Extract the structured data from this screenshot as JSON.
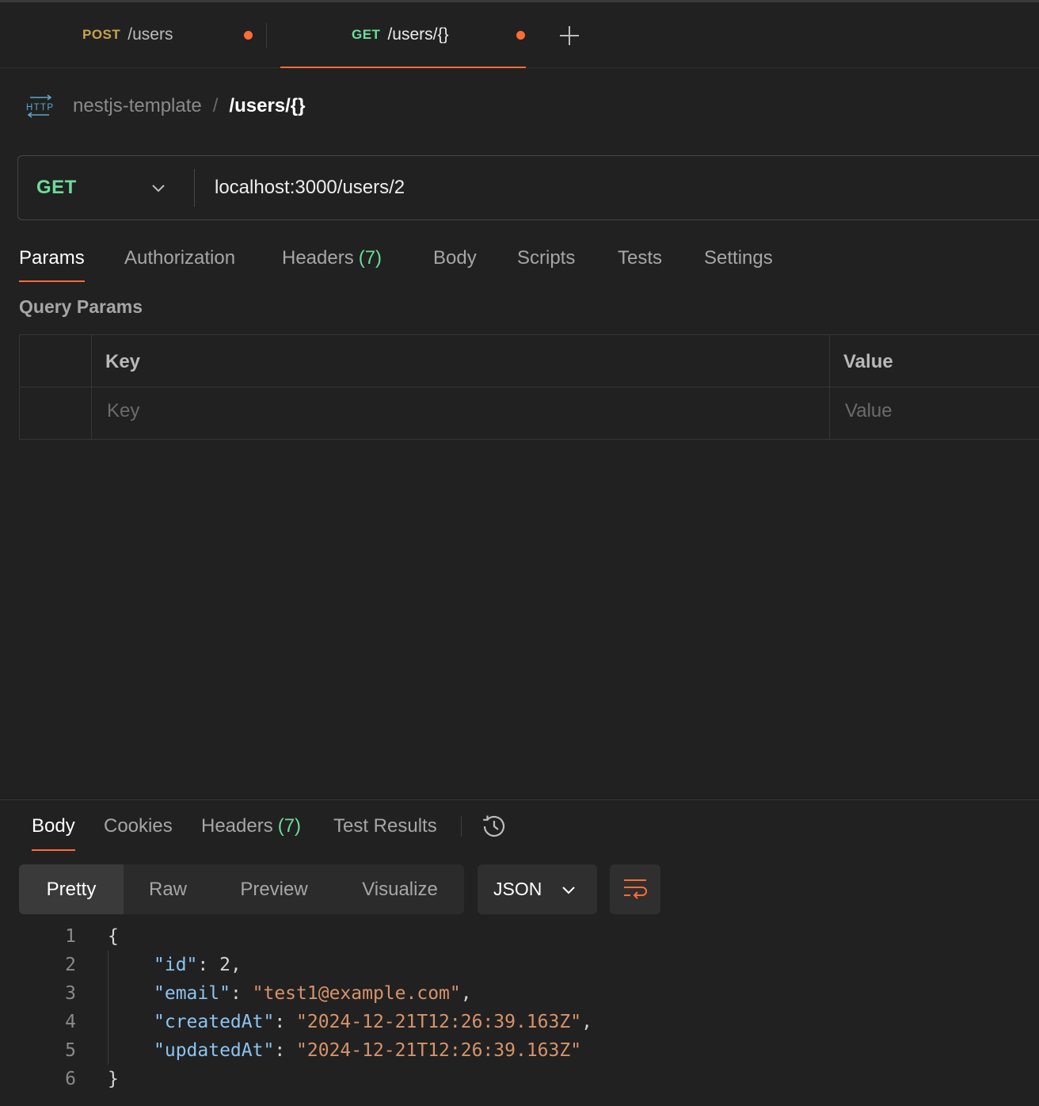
{
  "request_tabs": [
    {
      "method": "POST",
      "path": "/users",
      "method_color": "#c8a34a",
      "unsaved": true,
      "active": false
    },
    {
      "method": "GET",
      "path": "/users/{}",
      "method_color": "#6bdd9a",
      "unsaved": true,
      "active": true
    }
  ],
  "breadcrumb": {
    "icon": "http-icon",
    "collection": "nestjs-template",
    "separator": "/",
    "current": "/users/{}"
  },
  "url_bar": {
    "method": "GET",
    "url": "localhost:3000/users/2"
  },
  "request_subtabs": [
    {
      "label": "Params",
      "active": true
    },
    {
      "label": "Authorization"
    },
    {
      "label": "Headers",
      "count": "(7)"
    },
    {
      "label": "Body"
    },
    {
      "label": "Scripts"
    },
    {
      "label": "Tests"
    },
    {
      "label": "Settings"
    }
  ],
  "query_params": {
    "title": "Query Params",
    "columns": [
      "Key",
      "Value"
    ],
    "placeholders": {
      "key": "Key",
      "value": "Value"
    }
  },
  "response": {
    "tabs": [
      {
        "label": "Body",
        "active": true
      },
      {
        "label": "Cookies"
      },
      {
        "label": "Headers",
        "count": "(7)"
      },
      {
        "label": "Test Results"
      }
    ],
    "history_icon": "history-icon",
    "view_modes": [
      "Pretty",
      "Raw",
      "Preview",
      "Visualize"
    ],
    "active_view": "Pretty",
    "format": "JSON",
    "wrap_icon": "wrap-lines-icon",
    "code": {
      "line_numbers": [
        "1",
        "2",
        "3",
        "4",
        "5",
        "6"
      ],
      "open_brace": "{",
      "close_brace": "}",
      "entries": [
        {
          "key": "\"id\"",
          "value": "2",
          "type": "number",
          "comma": ","
        },
        {
          "key": "\"email\"",
          "value": "\"test1@example.com\"",
          "type": "string",
          "comma": ","
        },
        {
          "key": "\"createdAt\"",
          "value": "\"2024-12-21T12:26:39.163Z\"",
          "type": "string",
          "comma": ","
        },
        {
          "key": "\"updatedAt\"",
          "value": "\"2024-12-21T12:26:39.163Z\"",
          "type": "string",
          "comma": ""
        }
      ]
    }
  },
  "colors": {
    "accent": "#ff6c37",
    "get": "#6bdd9a",
    "post": "#c8a34a",
    "json_key": "#8bc4ef",
    "json_string": "#d7936a"
  }
}
